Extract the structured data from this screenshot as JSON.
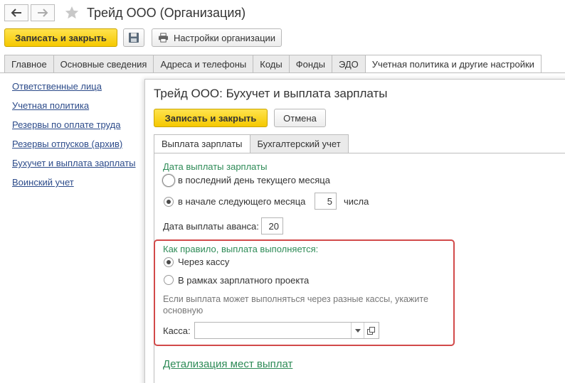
{
  "window": {
    "title": "Трейд ООО (Организация)"
  },
  "toolbar": {
    "save_close_label": "Записать и закрыть",
    "settings_label": "Настройки организации"
  },
  "tabs": [
    {
      "label": "Главное"
    },
    {
      "label": "Основные сведения"
    },
    {
      "label": "Адреса и телефоны"
    },
    {
      "label": "Коды"
    },
    {
      "label": "Фонды"
    },
    {
      "label": "ЭДО"
    },
    {
      "label": "Учетная политика и другие настройки"
    }
  ],
  "leftnav": {
    "items": [
      {
        "label": "Ответственные лица"
      },
      {
        "label": "Учетная политика"
      },
      {
        "label": "Резервы по оплате труда"
      },
      {
        "label": "Резервы отпусков (архив)"
      },
      {
        "label": "Бухучет и выплата зарплаты"
      },
      {
        "label": "Воинский учет"
      }
    ]
  },
  "dialog": {
    "title": "Трейд ООО: Бухучет и выплата зарплаты",
    "save_close_label": "Записать и закрыть",
    "cancel_label": "Отмена",
    "tabs": [
      {
        "label": "Выплата зарплаты"
      },
      {
        "label": "Бухгалтерский учет"
      }
    ],
    "pay_date": {
      "heading": "Дата выплаты зарплаты",
      "option_last_day": "в последний день текущего месяца",
      "option_next_month": "в начале следующего месяца",
      "day_value": "5",
      "day_suffix": "числа",
      "advance_label": "Дата выплаты аванса:",
      "advance_value": "20"
    },
    "payment_method": {
      "heading": "Как правило, выплата выполняется:",
      "option_cash": "Через кассу",
      "option_project": "В рамках зарплатного проекта",
      "hint": "Если выплата может выполняться через разные кассы, укажите основную",
      "cash_label": "Касса:",
      "cash_value": ""
    },
    "details_link": "Детализация мест выплат"
  },
  "colors": {
    "accent_yellow": "#f5c800",
    "green_text": "#2e8b57",
    "link_blue": "#2c4b8a",
    "highlight_red": "#d24a4a"
  }
}
